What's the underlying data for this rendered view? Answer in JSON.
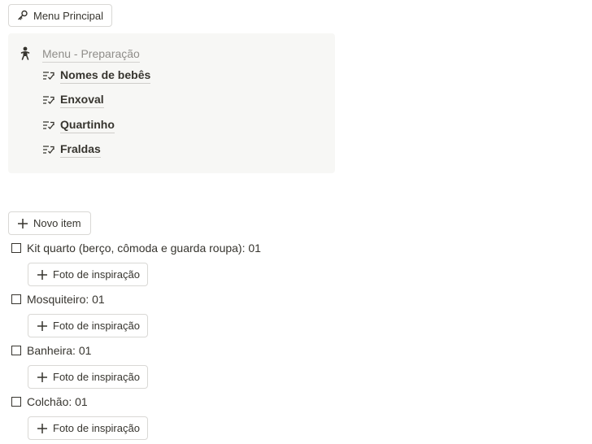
{
  "menu_button": {
    "label": "Menu Principal",
    "icon": "key-icon"
  },
  "callout": {
    "icon": "baby-icon",
    "title": "Menu - Preparação",
    "links": [
      {
        "label": "Nomes de bebês",
        "icon": "list-check-icon"
      },
      {
        "label": "Enxoval",
        "icon": "list-check-icon"
      },
      {
        "label": "Quartinho",
        "icon": "list-check-icon"
      },
      {
        "label": "Fraldas",
        "icon": "list-check-icon"
      }
    ]
  },
  "new_item_button": {
    "label": "Novo item"
  },
  "todos": [
    {
      "text": "Kit quarto (berço, cômoda e guarda roupa): 01",
      "checked": false,
      "action_label": "Foto de inspiração"
    },
    {
      "text": "Mosquiteiro: 01",
      "checked": false,
      "action_label": "Foto de inspiração"
    },
    {
      "text": "Banheira: 01",
      "checked": false,
      "action_label": "Foto de inspiração"
    },
    {
      "text": "Colchão: 01",
      "checked": false,
      "action_label": "Foto de inspiração"
    }
  ]
}
